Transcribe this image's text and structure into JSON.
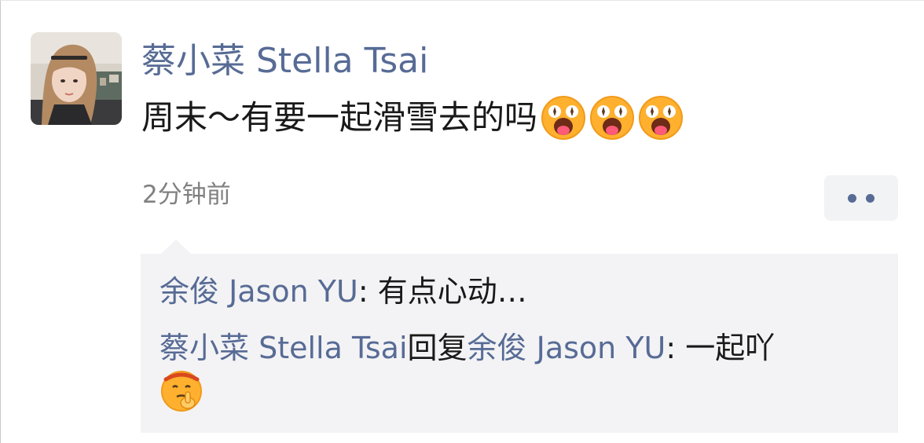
{
  "post": {
    "author": "蔡小菜 Stella Tsai",
    "text": "周末～有要一起滑雪去的吗",
    "emojis": [
      "excited-face-emoji",
      "excited-face-emoji",
      "excited-face-emoji"
    ],
    "time": "2分钟前",
    "more_icon": "more-dots-icon"
  },
  "comments": [
    {
      "author": "余俊 Jason YU",
      "separator": ": ",
      "text": "有点心动…"
    },
    {
      "author": "蔡小菜 Stella Tsai",
      "reply_word": "回复",
      "reply_to": "余俊 Jason YU",
      "separator": ": ",
      "text": "一起吖",
      "emoji": "shush-thinking-face-emoji"
    }
  ],
  "colors": {
    "name_blue": "#576b95",
    "text": "#191919",
    "time_gray": "#808080",
    "comment_bg": "#f3f3f5",
    "button_bg": "#f2f3f5"
  }
}
